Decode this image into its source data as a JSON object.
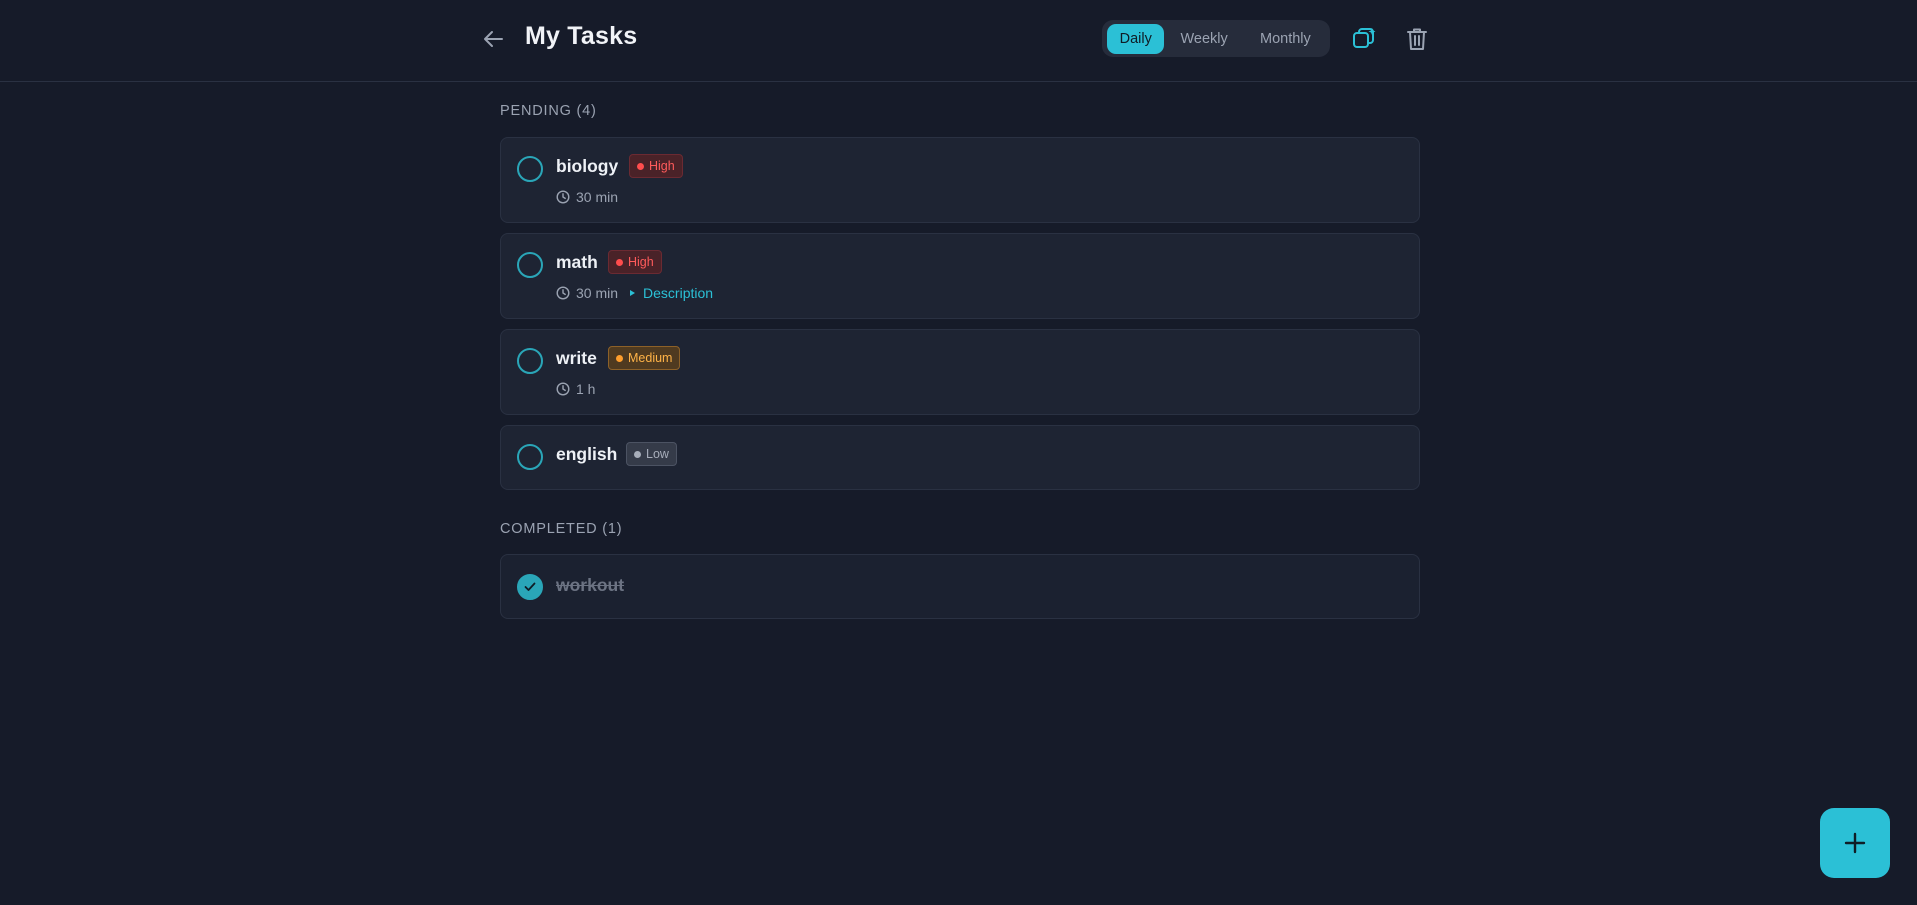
{
  "header": {
    "title": "My Tasks",
    "back_icon": "arrow-left-icon",
    "period_tabs": [
      {
        "label": "Daily",
        "active": true
      },
      {
        "label": "Weekly",
        "active": false
      },
      {
        "label": "Monthly",
        "active": false
      }
    ],
    "actions": [
      "sparkle-copy-icon",
      "trash-icon"
    ]
  },
  "pending": {
    "label": "PENDING (4)",
    "tasks": [
      {
        "title": "biology",
        "priority": "High",
        "duration": "30 min"
      },
      {
        "title": "math",
        "priority": "High",
        "duration": "30 min",
        "description_link": "Description"
      },
      {
        "title": "write",
        "priority": "Medium",
        "duration": "1 h"
      },
      {
        "title": "english",
        "priority": "Low"
      }
    ]
  },
  "completed": {
    "label": "COMPLETED (1)",
    "tasks": [
      {
        "title": "workout",
        "done": true
      }
    ]
  },
  "fab": {
    "icon": "plus-icon"
  },
  "colors": {
    "background": "#161b29",
    "card": "#1e2433",
    "accent": "#2bc0d6",
    "priority_high": "#ff5b5b",
    "priority_medium": "#ffb347",
    "priority_low": "#a7adba"
  }
}
